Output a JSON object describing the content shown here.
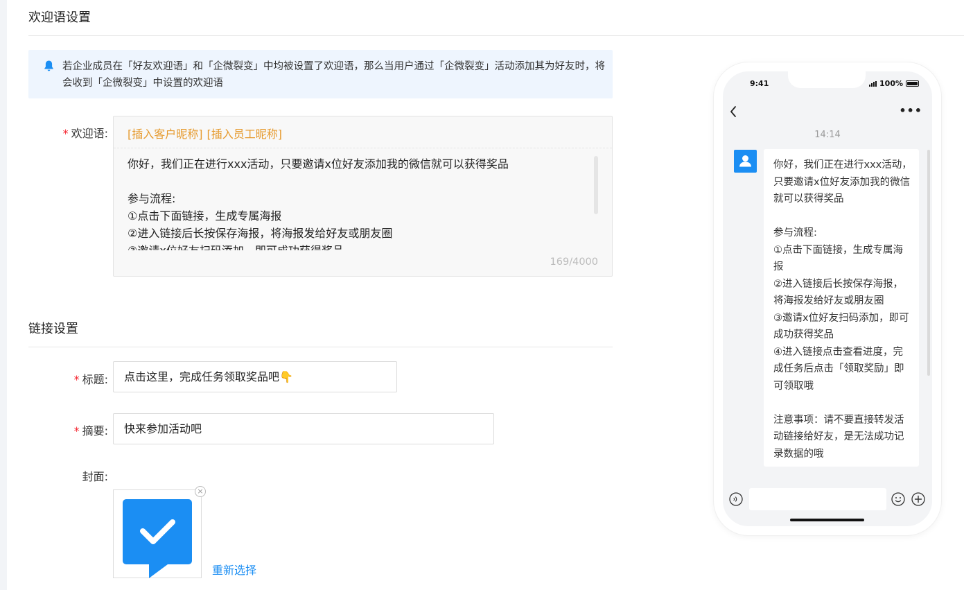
{
  "welcome_section": {
    "title": "欢迎语设置",
    "notice": "若企业成员在「好友欢迎语」和「企微裂变」中均被设置了欢迎语，那么当用户通过「企微裂变」活动添加其为好友时，将会收到「企微裂变」中设置的欢迎语",
    "required_mark": "*",
    "greeting_label": "欢迎语:",
    "insert_customer_nickname": "[插入客户昵称]",
    "insert_staff_nickname": "[插入员工昵称]",
    "greeting_text": "你好，我们正在进行xxx活动，只要邀请x位好友添加我的微信就可以获得奖品\n\n参与流程:\n①点击下面链接，生成专属海报\n②进入链接后长按保存海报，将海报发给好友或朋友圈\n③邀请x位好友扫码添加，即可成功获得奖品",
    "char_counter": "169/4000"
  },
  "link_section": {
    "title": "链接设置",
    "title_label": "标题:",
    "title_value": "点击这里，完成任务领取奖品吧👇",
    "summary_label": "摘要:",
    "summary_value": "快来参加活动吧",
    "cover_label": "封面:",
    "reselect_label": "重新选择",
    "cover_close": "×"
  },
  "phone_preview": {
    "status_time": "9:41",
    "battery": "100%",
    "more": "•••",
    "chat_time": "14:14",
    "message": "你好，我们正在进行xxx活动，只要邀请x位好友添加我的微信就可以获得奖品\n\n参与流程:\n①点击下面链接，生成专属海报\n②进入链接后长按保存海报，将海报发给好友或朋友圈\n③邀请x位好友扫码添加，即可成功获得奖品\n④进入链接点击查看进度，完成任务后点击「领取奖励」即可领取哦\n\n注意事项：请不要直接转发活动链接给好友，是无法成功记录数据的哦"
  },
  "colors": {
    "accent": "#1b8ef3",
    "insert_orange": "#e69a2d",
    "required_red": "#f5222d",
    "notice_bg": "#eef5fe"
  }
}
